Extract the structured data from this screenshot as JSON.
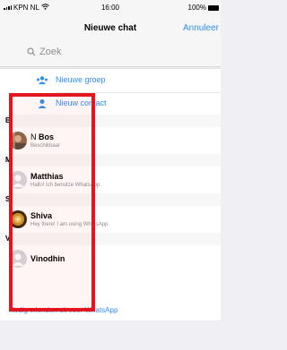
{
  "status_bar": {
    "carrier": "KPN NL",
    "time": "16:00",
    "battery": "100%"
  },
  "nav": {
    "title": "Nieuwe chat",
    "cancel": "Annuleer"
  },
  "search": {
    "placeholder": "Zoek"
  },
  "actions": [
    {
      "label": "Nieuwe groep",
      "icon": "group-icon"
    },
    {
      "label": "Nieuw contact",
      "icon": "add-contact-icon"
    }
  ],
  "sections": [
    {
      "letter": "B",
      "contacts": [
        {
          "first": "N",
          "last": "Bos",
          "status": "Beschikbaar",
          "avatar": "photo"
        }
      ]
    },
    {
      "letter": "M",
      "contacts": [
        {
          "first": "",
          "last": "Matthias",
          "status": "Hallo! Ich benutze WhatsApp.",
          "avatar": "placeholder"
        }
      ]
    },
    {
      "letter": "S",
      "contacts": [
        {
          "first": "",
          "last": "Shiva",
          "status": "Hey there! I am using WhatsApp.",
          "avatar": "photo"
        }
      ]
    },
    {
      "letter": "V",
      "contacts": [
        {
          "first": "",
          "last": "Vinodhin",
          "status": "",
          "avatar": "placeholder"
        }
      ]
    }
  ],
  "invite": "Nodig vrienden uit voor WhatsApp",
  "colors": {
    "accent": "#2e8ef7",
    "highlight": "#e3161f"
  }
}
